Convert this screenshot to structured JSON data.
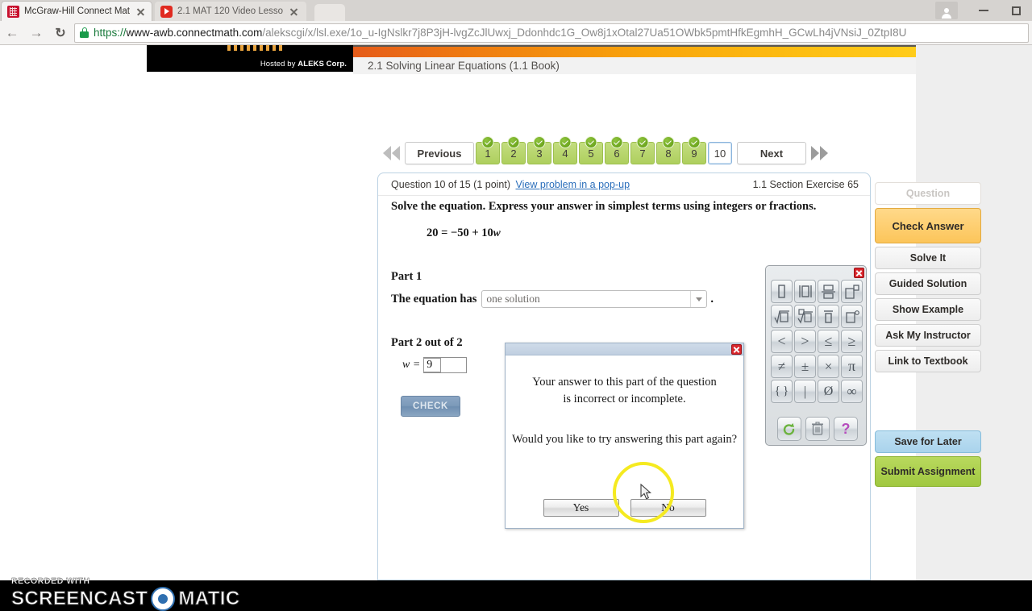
{
  "browser": {
    "tabs": [
      {
        "title": "McGraw-Hill Connect Mat",
        "favicon": "mcgrawhill-icon",
        "active": true
      },
      {
        "title": "2.1 MAT 120 Video Lesso",
        "favicon": "youtube-icon",
        "active": false
      }
    ],
    "back_icon": "back-arrow-icon",
    "forward_icon": "forward-arrow-icon",
    "reload_icon": "reload-icon",
    "lock_icon": "lock-icon",
    "url_scheme": "https://",
    "url_host": "www-awb.connectmath.com",
    "url_path": "/alekscgi/x/lsl.exe/1o_u-IgNslkr7j8P3jH-lvgZcJlUwxj_Ddonhdc1G_Ow8j1xOtal27Ua51OWbk5pmtHfkEgmhH_GCwLh4jVNsiJ_0ZtpI8U",
    "profile_icon": "profile-icon",
    "minimize_icon": "minimize-icon",
    "maximize_icon": "maximize-icon",
    "new_tab_icon": "new-tab-icon"
  },
  "banner": {
    "hosted_prefix": "Hosted by ",
    "hosted_brand": "ALEKS Corp.",
    "lesson_title": "2.1 Solving Linear Equations (1.1 Book)"
  },
  "nav": {
    "first_icon": "double-left-arrow-icon",
    "previous_label": "Previous",
    "next_label": "Next",
    "last_icon": "double-right-arrow-icon",
    "question_numbers": [
      {
        "label": "1",
        "state": "done"
      },
      {
        "label": "2",
        "state": "done"
      },
      {
        "label": "3",
        "state": "done"
      },
      {
        "label": "4",
        "state": "done"
      },
      {
        "label": "5",
        "state": "done"
      },
      {
        "label": "6",
        "state": "done"
      },
      {
        "label": "7",
        "state": "done"
      },
      {
        "label": "8",
        "state": "done"
      },
      {
        "label": "9",
        "state": "done"
      },
      {
        "label": "10",
        "state": "current"
      }
    ]
  },
  "question": {
    "counter": "Question 10 of 15 (1 point)",
    "popup_link": "View problem in a pop-up",
    "exercise_ref": "1.1 Section Exercise 65",
    "prompt": "Solve the equation. Express your answer in simplest terms using integers or fractions.",
    "equation_lhs": "20 = −50 + 10",
    "equation_var": "w",
    "part1": {
      "heading": "Part 1",
      "label": "The equation has",
      "dropdown_value": "one solution",
      "dropdown_icon": "chevron-down-icon",
      "trailing_punctuation": "."
    },
    "part2": {
      "heading": "Part 2 out of 2",
      "variable": "w  =",
      "answer_value": "9",
      "check_label": "CHECK"
    }
  },
  "keypad": {
    "close_icon": "close-icon",
    "keys": [
      {
        "name": "box-icon",
        "glyph": "▭"
      },
      {
        "name": "absolute-value-icon",
        "glyph": "|▭|"
      },
      {
        "name": "fraction-icon",
        "glyph": "▭̸"
      },
      {
        "name": "exponent-icon",
        "glyph": "▭▫"
      },
      {
        "name": "square-root-icon",
        "glyph": "√▭"
      },
      {
        "name": "nth-root-icon",
        "glyph": "ⁿ√▭"
      },
      {
        "name": "overline-icon",
        "glyph": "̅▭"
      },
      {
        "name": "degree-icon",
        "glyph": "▭°"
      },
      {
        "name": "less-than-icon",
        "glyph": "<"
      },
      {
        "name": "greater-than-icon",
        "glyph": ">"
      },
      {
        "name": "less-equal-icon",
        "glyph": "≤"
      },
      {
        "name": "greater-equal-icon",
        "glyph": "≥"
      },
      {
        "name": "not-equal-icon",
        "glyph": "≠"
      },
      {
        "name": "plus-minus-icon",
        "glyph": "±"
      },
      {
        "name": "multiply-icon",
        "glyph": "×"
      },
      {
        "name": "pi-icon",
        "glyph": "π"
      },
      {
        "name": "braces-icon",
        "glyph": "{ }"
      },
      {
        "name": "pipe-icon",
        "glyph": "|"
      },
      {
        "name": "empty-set-icon",
        "glyph": "Ø"
      },
      {
        "name": "infinity-icon",
        "glyph": "∞"
      }
    ],
    "footer_keys": [
      {
        "name": "undo-icon",
        "glyph": "↻"
      },
      {
        "name": "trash-icon",
        "glyph": "Ὕ1"
      },
      {
        "name": "help-icon",
        "glyph": "?"
      }
    ]
  },
  "dialog": {
    "close_icon": "close-icon",
    "line1": "Your answer to this part of the question",
    "line2": "is incorrect or incomplete.",
    "line3": "Would you like to try answering this part again?",
    "yes_label": "Yes",
    "no_label": "No",
    "highlight_color": "#f5ea20"
  },
  "sidebar": {
    "buttons": [
      {
        "label": "Question",
        "name": "question-button",
        "style": "question"
      },
      {
        "label": "Check Answer",
        "name": "check-answer-button",
        "style": "primary"
      },
      {
        "label": "Solve It",
        "name": "solve-it-button",
        "style": "normal"
      },
      {
        "label": "Guided Solution",
        "name": "guided-solution-button",
        "style": "normal"
      },
      {
        "label": "Show Example",
        "name": "show-example-button",
        "style": "normal"
      },
      {
        "label": "Ask My Instructor",
        "name": "ask-my-instructor-button",
        "style": "normal"
      },
      {
        "label": "Link to Textbook",
        "name": "link-to-textbook-button",
        "style": "normal"
      }
    ],
    "save_label": "Save for Later",
    "submit_label": "Submit Assignment",
    "accent_primary": "#fcc55a",
    "accent_submit": "#a0c840",
    "accent_save": "#a9d3ec"
  },
  "watermark": {
    "top_line": "RECORDED WITH",
    "word1": "SCREENCAST",
    "word2": "MATIC",
    "logo_icon": "screencast-o-matic-logo"
  }
}
